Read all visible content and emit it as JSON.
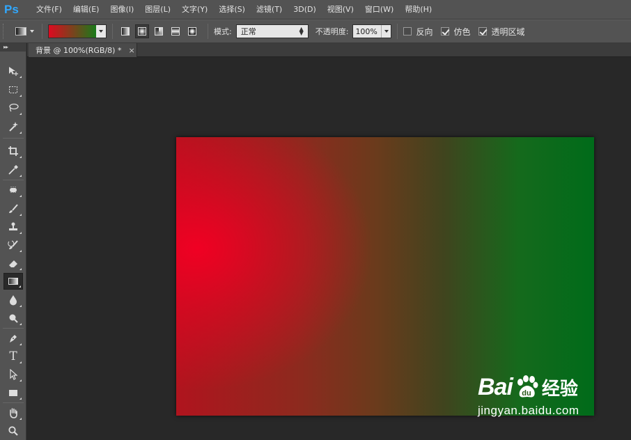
{
  "app": {
    "logo": "Ps"
  },
  "menu": [
    "文件(F)",
    "编辑(E)",
    "图像(I)",
    "图层(L)",
    "文字(Y)",
    "选择(S)",
    "滤镜(T)",
    "3D(D)",
    "视图(V)",
    "窗口(W)",
    "帮助(H)"
  ],
  "options": {
    "gradient_colors": [
      "#dd0a20",
      "#1a7a1a"
    ],
    "gradient_types": [
      "linear-gradient-icon",
      "radial-gradient-icon",
      "angle-gradient-icon",
      "reflected-gradient-icon",
      "diamond-gradient-icon"
    ],
    "active_gradient_type": "radial-gradient-icon",
    "mode_label": "模式:",
    "mode_value": "正常",
    "opacity_label": "不透明度:",
    "opacity_value": "100%",
    "reverse_label": "反向",
    "reverse_checked": false,
    "dither_label": "仿色",
    "dither_checked": true,
    "transparency_label": "透明区域",
    "transparency_checked": true
  },
  "tools": [
    "move-tool-icon",
    "marquee-tool-icon",
    "lasso-tool-icon",
    "magic-wand-tool-icon",
    "crop-tool-icon",
    "eyedropper-tool-icon",
    "healing-brush-tool-icon",
    "brush-tool-icon",
    "clone-stamp-tool-icon",
    "history-brush-tool-icon",
    "eraser-tool-icon",
    "gradient-tool-icon",
    "blur-tool-icon",
    "dodge-tool-icon",
    "pen-tool-icon",
    "type-tool-icon",
    "path-selection-tool-icon",
    "rectangle-tool-icon",
    "hand-tool-icon",
    "zoom-tool-icon"
  ],
  "active_tool": "gradient-tool-icon",
  "document_tab": {
    "title": "背景 @ 100%(RGB/8) *",
    "close": "×"
  },
  "canvas": {
    "gradient_start_color": "#f00023",
    "gradient_end_color": "#006b1a"
  },
  "watermark": {
    "brand_prefix": "Bai",
    "brand_suffix": "经验",
    "url": "jingyan.baidu.com"
  }
}
